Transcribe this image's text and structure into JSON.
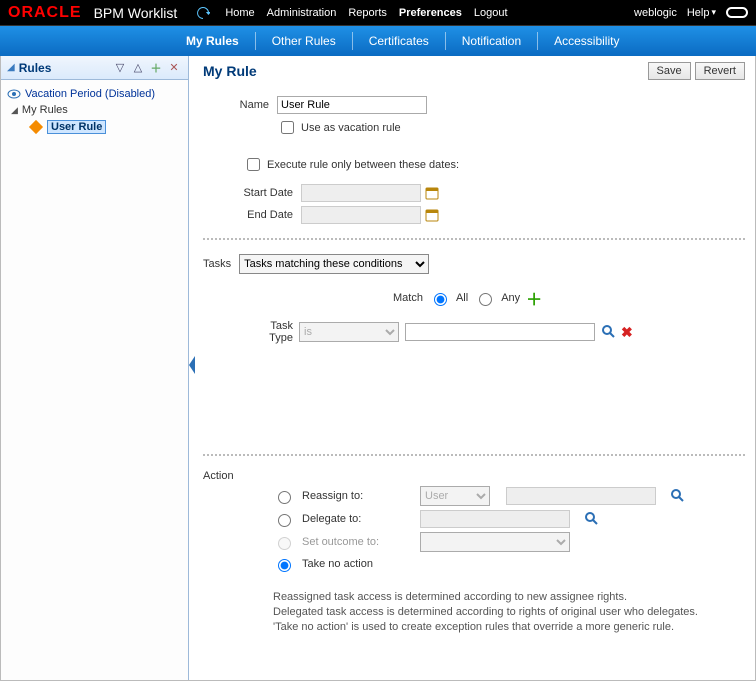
{
  "brand": "ORACLE",
  "app_title": "BPM Worklist",
  "top_nav": {
    "home": "Home",
    "administration": "Administration",
    "reports": "Reports",
    "preferences": "Preferences",
    "logout": "Logout",
    "user": "weblogic",
    "help": "Help"
  },
  "blue_tabs": {
    "my_rules": "My Rules",
    "other_rules": "Other Rules",
    "certificates": "Certificates",
    "notification": "Notification",
    "accessibility": "Accessibility"
  },
  "left": {
    "title": "Rules",
    "vacation": "Vacation Period (Disabled)",
    "my_rules": "My Rules",
    "user_rule": "User Rule"
  },
  "right": {
    "title": "My Rule",
    "save": "Save",
    "revert": "Revert",
    "name_label": "Name",
    "name_value": "User Rule",
    "use_as_vacation": "Use as vacation rule",
    "execute_between": "Execute rule only between these dates:",
    "start_date": "Start Date",
    "end_date": "End Date",
    "tasks_label": "Tasks",
    "tasks_select": "Tasks matching these conditions",
    "match_label": "Match",
    "all": "All",
    "any": "Any",
    "task_type_label": "Task Type",
    "task_type_op": "is",
    "action_label": "Action",
    "reassign": "Reassign to:",
    "reassign_type": "User",
    "delegate": "Delegate to:",
    "set_outcome": "Set outcome to:",
    "take_no_action": "Take no action",
    "foot1": "Reassigned task access is determined according to new assignee rights.",
    "foot2": "Delegated task access is determined according to rights of original user who delegates.",
    "foot3": "'Take no action' is used to create exception rules that override a more generic rule."
  }
}
